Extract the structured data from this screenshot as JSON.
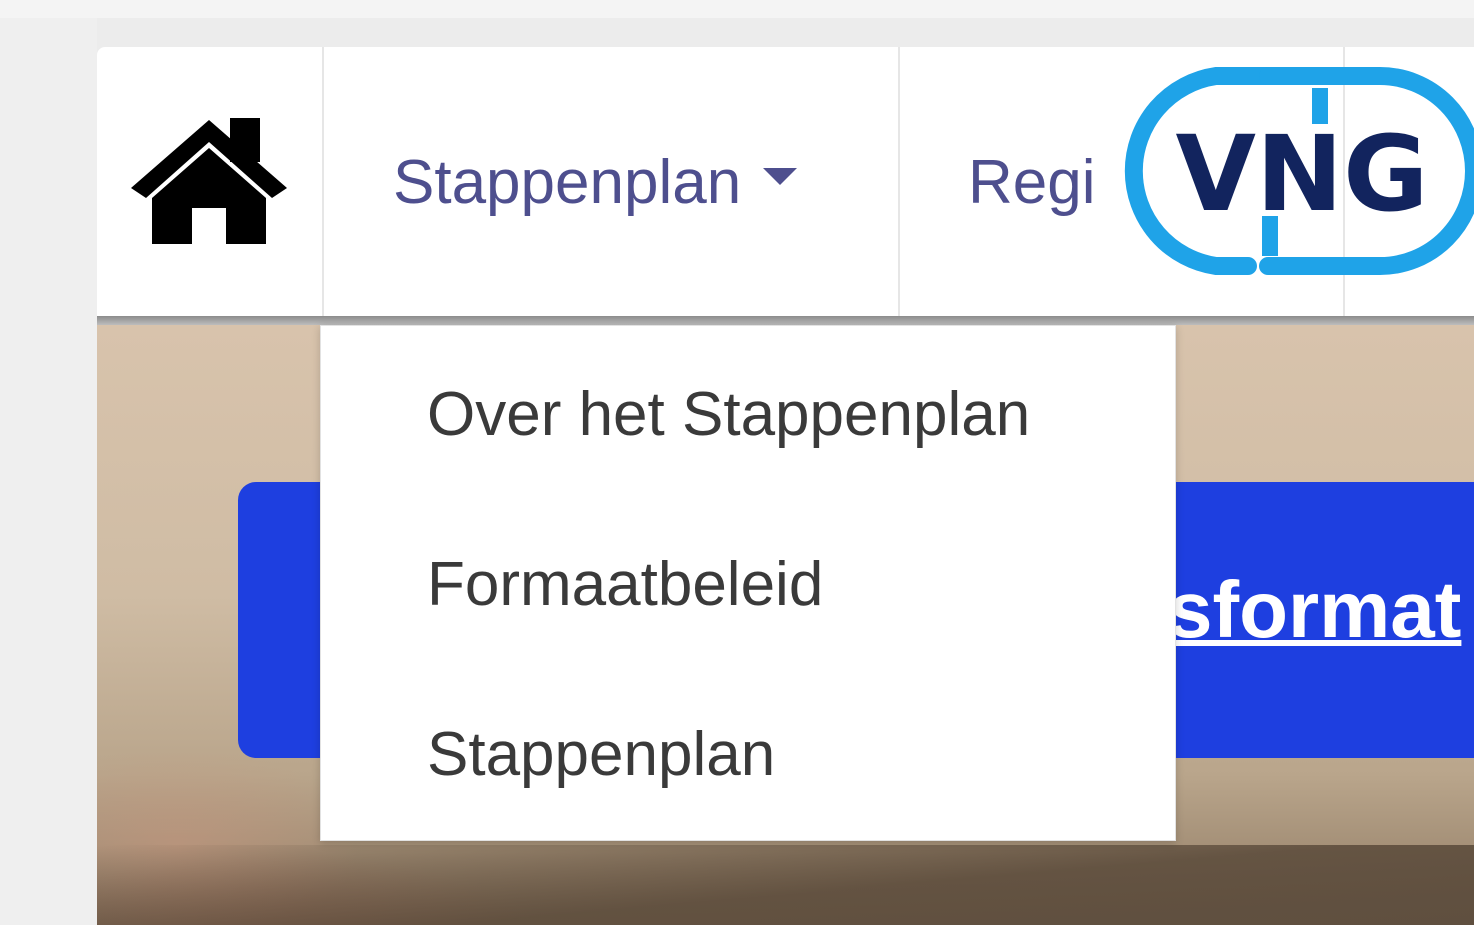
{
  "colors": {
    "nav_link": "#4e4f8e",
    "banner_blue": "#1e3fe0",
    "logo_ring": "#1fa3e8",
    "logo_text": "#12245e"
  },
  "nav": {
    "home_icon": "home-icon",
    "items": [
      {
        "label": "Stappenplan",
        "has_dropdown": true,
        "icon": "caret-down-icon"
      },
      {
        "label": "Regi"
      }
    ]
  },
  "dropdown": {
    "items": [
      {
        "label": "Over het Stappenplan"
      },
      {
        "label": "Formaatbeleid"
      },
      {
        "label": "Stappenplan"
      }
    ]
  },
  "banner": {
    "text": "sformat"
  },
  "logo": {
    "text": "VNG"
  }
}
